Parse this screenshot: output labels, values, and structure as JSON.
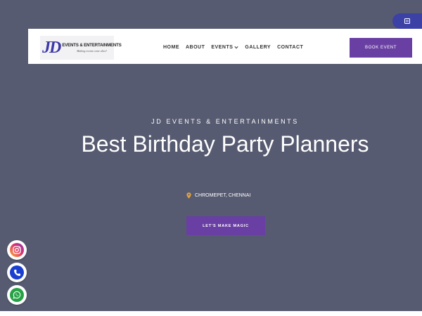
{
  "colors": {
    "hero_bg": "#575b71",
    "accent_purple": "#6a3fa3",
    "pill_blue": "#3c41a6",
    "location_pin": "#e8a33a",
    "phone_blue": "#1a3fd0",
    "whatsapp_green": "#25a244"
  },
  "header": {
    "logo": {
      "mark": "JD",
      "name": "EVENTS & ENTERTAINMENTS",
      "tagline": "Making events come alive!"
    },
    "nav": [
      {
        "label": "HOME",
        "has_dropdown": false
      },
      {
        "label": "ABOUT",
        "has_dropdown": false
      },
      {
        "label": "EVENTS",
        "has_dropdown": true
      },
      {
        "label": "GALLERY",
        "has_dropdown": false
      },
      {
        "label": "CONTACT",
        "has_dropdown": false
      }
    ],
    "cta_label": "BOOK EVENT"
  },
  "top_right_icon": "grid-icon",
  "hero": {
    "subtitle": "JD EVENTS & ENTERTAINMENTS",
    "title": "Best Birthday Party Planners",
    "location": "CHROMEPET, CHENNAI",
    "location_icon": "map-pin-icon",
    "cta_label": "LET'S MAKE MAGIC"
  },
  "floating_icons": [
    "instagram-icon",
    "phone-icon",
    "whatsapp-icon"
  ]
}
